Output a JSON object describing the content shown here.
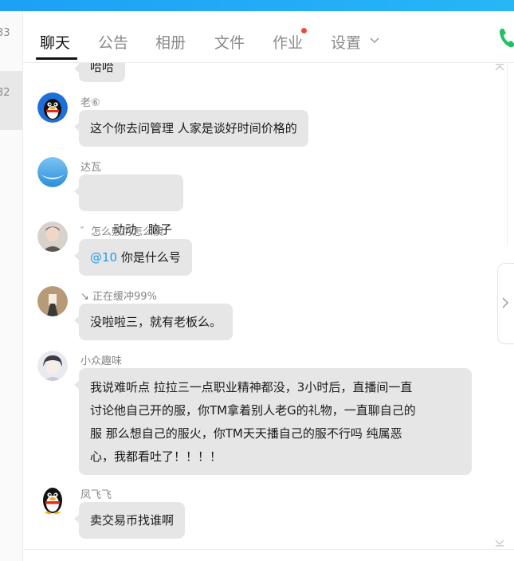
{
  "window": {
    "title": ""
  },
  "left_list": {
    "items": [
      {
        "label": "33"
      },
      {
        "label": "32"
      }
    ]
  },
  "tabs": [
    {
      "label": "聊天",
      "active": true
    },
    {
      "label": "公告"
    },
    {
      "label": "相册"
    },
    {
      "label": "文件"
    },
    {
      "label": "作业",
      "has_badge": true
    },
    {
      "label": "设置",
      "has_dropdown": true
    }
  ],
  "colors": {
    "title_bar": "#1ea0f5",
    "badge": "#f5483b",
    "bubble": "#e6e6e6",
    "mention": "#2a98e6",
    "phone": "#21c163"
  },
  "messages": [
    {
      "text": "哈哈",
      "avatar": "partial"
    },
    {
      "sender": "老⑥",
      "text": "这个你去问管理 人家是谈好时间价格的",
      "avatar": "qq-penguin-icon"
    },
    {
      "sender": "达瓦",
      "text": "动动   脑子",
      "avatar": "blue-sky-avatar"
    },
    {
      "sender": "゛怎么敷衍怎么演",
      "mention": "@10",
      "text": " 你是什么号",
      "avatar": "person-photo-avatar"
    },
    {
      "sender": "↘ 正在缓冲99%",
      "text": "没啦啦三，就有老板么。",
      "avatar": "person-photo-avatar"
    },
    {
      "sender": "小众趣味",
      "lines": [
        "我说难听点 拉拉三一点职业精神都没，3小时后，直播间一直",
        "讨论他自己开的服，你TM拿着别人老G的礼物，一直聊自己的",
        "服 那么想自己的服火，你TM天天播自己的服不行吗 纯属恶",
        "心，我都看吐了！！！！"
      ],
      "avatar": "anime-avatar"
    },
    {
      "sender": "凤飞飞",
      "text": "卖交易币找谁啊",
      "avatar": "qq-penguin-icon"
    }
  ]
}
